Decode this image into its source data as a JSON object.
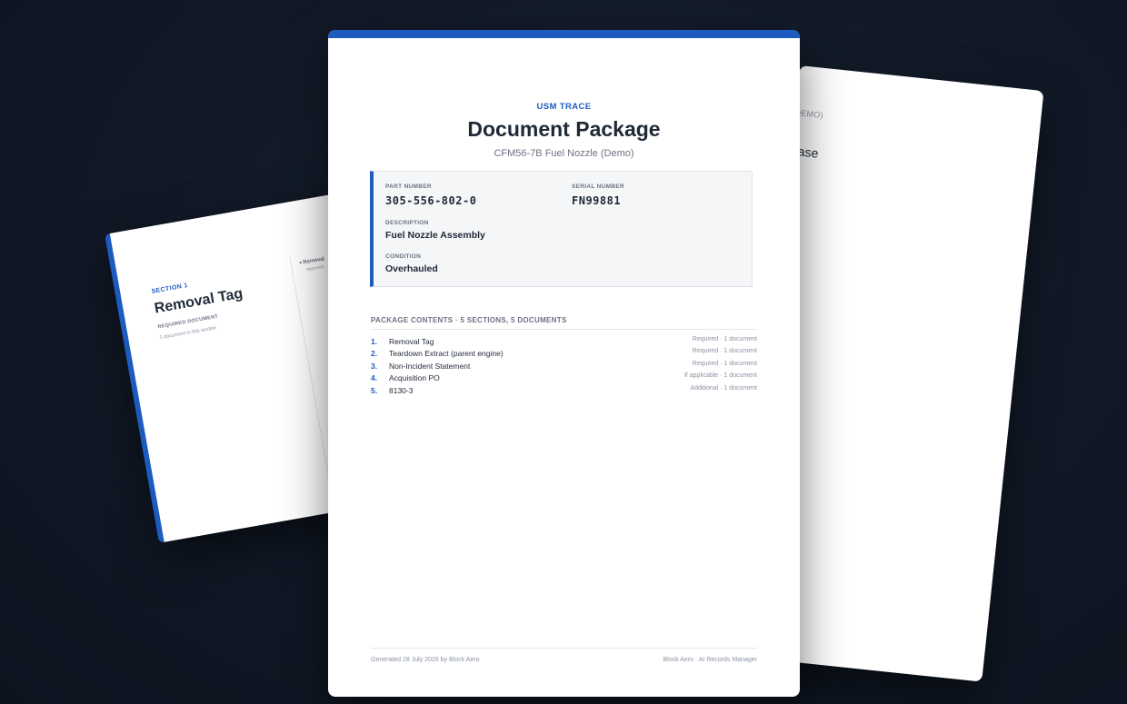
{
  "back_right_page": {
    "fragment_demo": "DEMO)",
    "fragment_ease": "ease"
  },
  "back_left_page": {
    "section_label": "SECTION 1",
    "section_title": "Removal Tag",
    "required_label": "REQUIRED DOCUMENT",
    "doc_count_text": "1 document in this section",
    "toc_fragment": "Removal",
    "toc_fragment_sub": "Approved"
  },
  "front_page": {
    "eyebrow": "USM TRACE",
    "title": "Document Package",
    "subtitle": "CFM56-7B Fuel Nozzle (Demo)",
    "fields": {
      "part_number_label": "PART NUMBER",
      "part_number": "305-556-802-0",
      "serial_number_label": "SERIAL NUMBER",
      "serial_number": "FN99881",
      "description_label": "DESCRIPTION",
      "description": "Fuel Nozzle Assembly",
      "condition_label": "CONDITION",
      "condition": "Overhauled"
    },
    "contents_header": "PACKAGE CONTENTS  ·  5 SECTIONS, 5 DOCUMENTS",
    "contents": [
      {
        "num": "1.",
        "name": "Removal Tag",
        "meta": "Required  ·  1 document"
      },
      {
        "num": "2.",
        "name": "Teardown Extract (parent engine)",
        "meta": "Required  ·  1 document"
      },
      {
        "num": "3.",
        "name": "Non-Incident Statement",
        "meta": "Required  ·  1 document"
      },
      {
        "num": "4.",
        "name": "Acquisition PO",
        "meta": "If applicable  ·  1 document"
      },
      {
        "num": "5.",
        "name": "8130-3",
        "meta": "Additional  ·  1 document"
      }
    ],
    "footer_left": "Generated 28 July 2026  by Block Aero",
    "footer_right": "Block Aero  ·  AI Records Manager"
  },
  "colors": {
    "accent": "#1e5bbf",
    "background": "#121a28",
    "text": "#1f2937",
    "muted": "#6b7280"
  }
}
